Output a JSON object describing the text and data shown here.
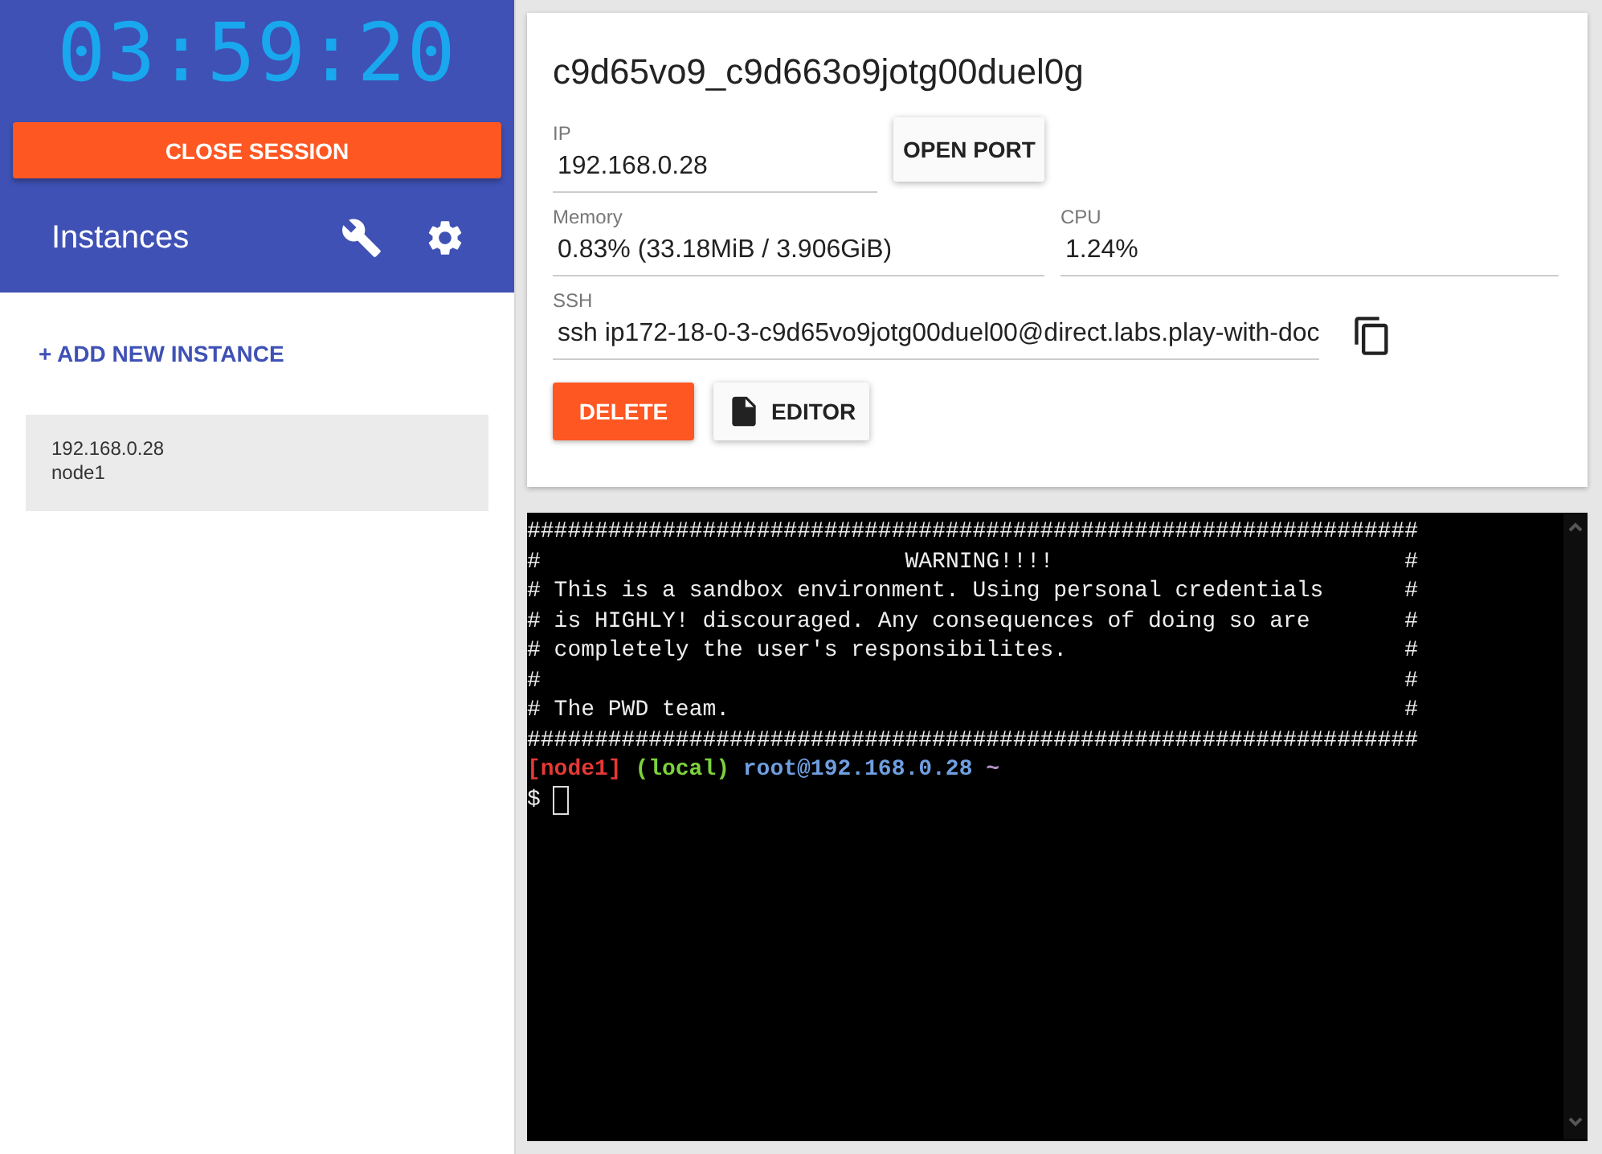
{
  "sidebar": {
    "timer": "03:59:20",
    "close_button": "CLOSE SESSION",
    "title": "Instances",
    "add_button": "+ ADD NEW INSTANCE",
    "instances": [
      {
        "ip": "192.168.0.28",
        "name": "node1",
        "selected": true
      }
    ]
  },
  "instance": {
    "title": "c9d65vo9_c9d663o9jotg00duel0g",
    "fields": [
      {
        "label": "IP",
        "value": "192.168.0.28"
      },
      {
        "label": "Memory",
        "value": "0.83% (33.18MiB / 3.906GiB)"
      },
      {
        "label": "CPU",
        "value": "1.24%"
      },
      {
        "label": "SSH",
        "value": "ssh ip172-18-0-3-c9d65vo9jotg00duel00@direct.labs.play-with-doc"
      }
    ],
    "open_port_button": "OPEN PORT",
    "delete_button": "DELETE",
    "editor_button": "EDITOR"
  },
  "terminal": {
    "lines": [
      "##################################################################",
      "#                           WARNING!!!!                          #",
      "# This is a sandbox environment. Using personal credentials      #",
      "# is HIGHLY! discouraged. Any consequences of doing so are       #",
      "# completely the user's responsibilites.                         #",
      "#                                                                #",
      "# The PWD team.                                                  #",
      "##################################################################"
    ],
    "prompt": [
      {
        "text": "[node1]",
        "color": "#e53935"
      },
      {
        "text": "(local)",
        "color": "#7cd23c"
      },
      {
        "text": "root@192.168.0.28",
        "color": "#6f9fe0"
      },
      {
        "text": "~",
        "color": "#b38fc4"
      }
    ],
    "input_prompt": "$"
  }
}
